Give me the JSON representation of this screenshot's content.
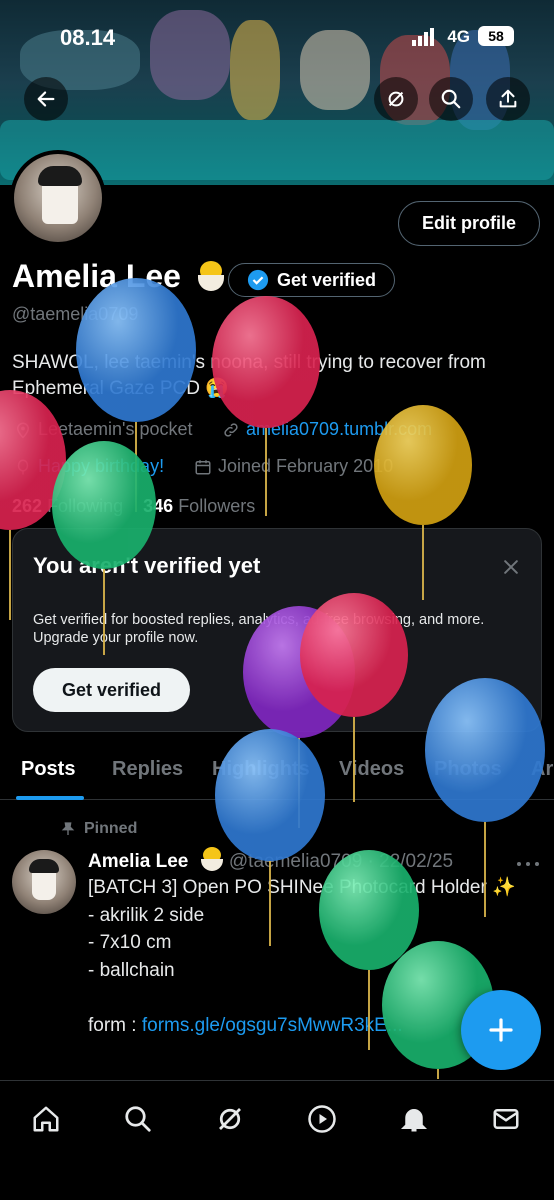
{
  "status_bar": {
    "time": "08.14",
    "network": "4G",
    "battery": "58"
  },
  "profile": {
    "name": "Amelia Lee",
    "handle": "@taemelia0709",
    "edit_label": "Edit profile",
    "get_verified_label": "Get verified",
    "bio": "SHAWOL, lee taemin's noona, still trying to recover from Ephemeral Gaze PCD 😭",
    "location": "Leetaemin's pocket",
    "website": "amelia0709.tumblr.com",
    "birthday": "Happy birthday!",
    "joined": "Joined February 2010",
    "following_count": "262",
    "following_label": "Following",
    "followers_count": "346",
    "followers_label": "Followers"
  },
  "verify_card": {
    "title": "You aren't verified yet",
    "description": "Get verified for boosted replies, analytics, ad-free browsing, and more. Upgrade your profile now.",
    "button": "Get verified"
  },
  "tabs": [
    "Posts",
    "Replies",
    "Highlights",
    "Videos",
    "Photos",
    "Ar"
  ],
  "active_tab": "Posts",
  "post": {
    "pinned_label": "Pinned",
    "author": "Amelia Lee",
    "handle_date": "@taemelia0709 · 22/02/25",
    "text": "[BATCH 3] Open PO SHINee Photocard Holder ✨\n- akrilik 2 side\n- 7x10 cm\n- ballchain\n\nform : ",
    "link": "forms.gle/ogsgu7sMwwR3kE..."
  },
  "colors": {
    "accent": "#1d9bf0",
    "background": "#000000",
    "muted": "#71767b"
  },
  "icons": [
    "back-arrow-icon",
    "grok-icon",
    "search-icon",
    "share-icon",
    "verified-badge-icon",
    "location-icon",
    "link-icon",
    "balloon-icon",
    "calendar-icon",
    "close-icon",
    "pin-icon",
    "more-icon",
    "plus-icon",
    "home-icon",
    "search-nav-icon",
    "grok-nav-icon",
    "play-icon",
    "bell-icon",
    "mail-icon"
  ]
}
